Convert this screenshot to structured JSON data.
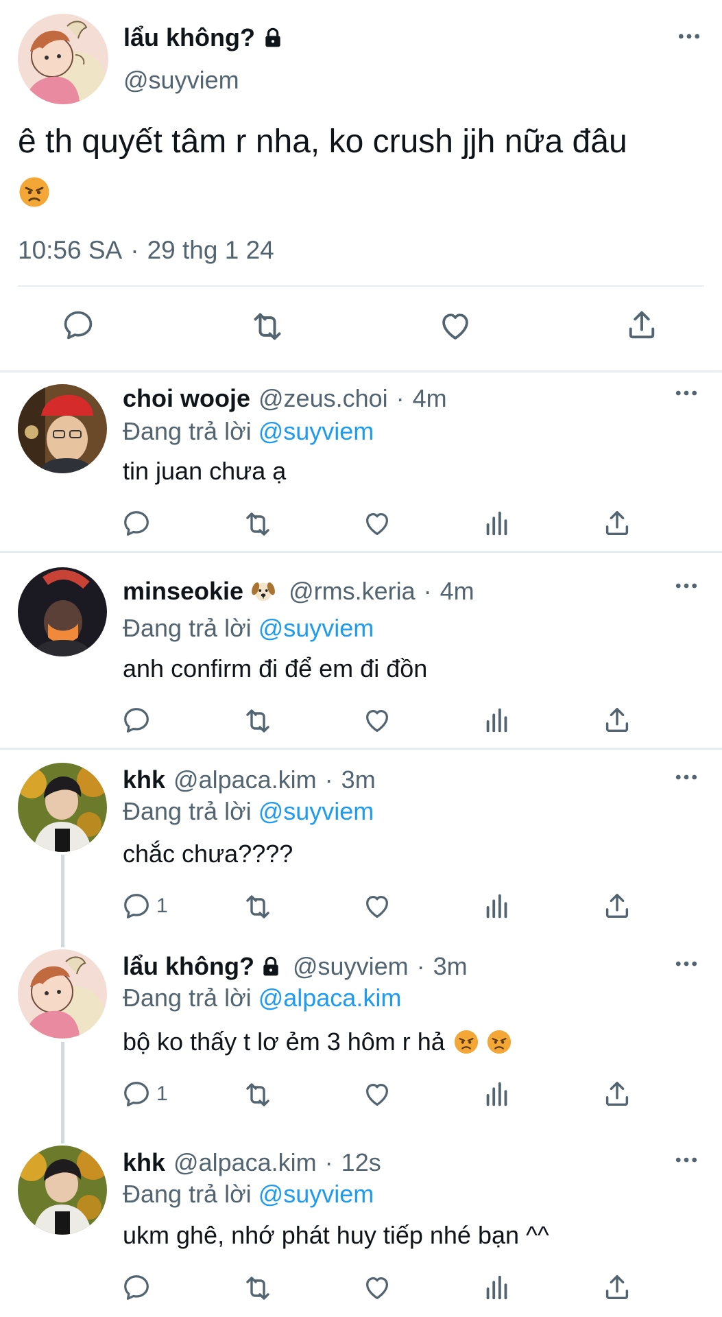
{
  "main_tweet": {
    "display_name": "lẩu không?",
    "handle": "@suyviem",
    "text": "ê th quyết tâm r nha, ko crush jjh nữa đâu",
    "time": "10:56 SA",
    "dot": "·",
    "date": "29 thg 1 24",
    "icons": [
      "lock-icon",
      "more-icon",
      "reply-icon",
      "retweet-icon",
      "like-icon",
      "share-icon",
      "angry-face-emoji"
    ]
  },
  "replies": [
    {
      "name": "choi wooje",
      "handle": "@zeus.choi",
      "dot": "·",
      "time": "4m",
      "replying_prefix": "Đang trả lời",
      "replying_to": "@suyviem",
      "text": "tin juan chưa ạ",
      "reply_count": ""
    },
    {
      "name": "minseokie",
      "handle": "@rms.keria",
      "dot": "·",
      "time": "4m",
      "replying_prefix": "Đang trả lời",
      "replying_to": "@suyviem",
      "text": "anh confirm đi để em đi đồn",
      "reply_count": ""
    },
    {
      "name": "khk",
      "handle": "@alpaca.kim",
      "dot": "·",
      "time": "3m",
      "replying_prefix": "Đang trả lời",
      "replying_to": "@suyviem",
      "text": "chắc chưa????",
      "reply_count": "1"
    },
    {
      "name": "lẩu không?",
      "handle": "@suyviem",
      "dot": "·",
      "time": "3m",
      "replying_prefix": "Đang trả lời",
      "replying_to": "@alpaca.kim",
      "text": "bộ ko thấy t lơ ẻm 3 hôm r hả",
      "reply_count": "1"
    },
    {
      "name": "khk",
      "handle": "@alpaca.kim",
      "dot": "·",
      "time": "12s",
      "replying_prefix": "Đang trả lời",
      "replying_to": "@suyviem",
      "text": "ukm ghê, nhớ phát huy tiếp nhé bạn ^^",
      "reply_count": ""
    }
  ],
  "colors": {
    "text": "#0f1419",
    "secondary": "#536471",
    "accent": "#1d9bf0",
    "divider": "#e6ecf0"
  }
}
